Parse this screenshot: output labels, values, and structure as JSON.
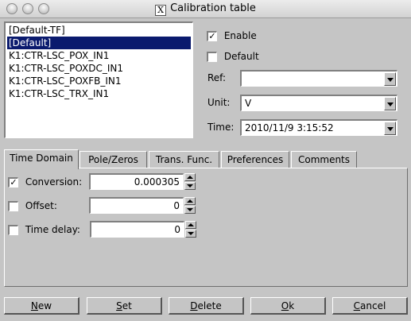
{
  "window": {
    "title": "Calibration table",
    "title_icon_glyph": "X"
  },
  "list": {
    "items": [
      "[Default-TF]",
      "[Default]",
      "K1:CTR-LSC_POX_IN1",
      "K1:CTR-LSC_POXDC_IN1",
      "K1:CTR-LSC_POXFB_IN1",
      "K1:CTR-LSC_TRX_IN1"
    ],
    "selected_index": 1,
    "selection_color": "#0a1a6e"
  },
  "options": {
    "enable": {
      "label": "Enable",
      "checked": true
    },
    "default": {
      "label": "Default",
      "checked": false
    }
  },
  "fields": {
    "ref": {
      "label": "Ref:",
      "value": ""
    },
    "unit": {
      "label": "Unit:",
      "value": "V"
    },
    "time": {
      "label": "Time:",
      "value": "2010/11/9 3:15:52"
    }
  },
  "tabs": [
    "Time Domain",
    "Pole/Zeros",
    "Trans. Func.",
    "Preferences",
    "Comments"
  ],
  "active_tab": "Time Domain",
  "time_domain": {
    "conversion": {
      "label": "Conversion:",
      "checked": true,
      "value": "0.000305"
    },
    "offset": {
      "label": "Offset:",
      "checked": false,
      "value": "0"
    },
    "delay": {
      "label": "Time delay:",
      "checked": false,
      "value": "0"
    }
  },
  "buttons": {
    "new": {
      "first": "N",
      "rest": "ew"
    },
    "set": {
      "first": "S",
      "rest": "et"
    },
    "delete": {
      "first": "D",
      "rest": "elete"
    },
    "ok": {
      "first": "O",
      "rest": "k"
    },
    "cancel": {
      "first": "C",
      "rest": "ancel"
    }
  }
}
